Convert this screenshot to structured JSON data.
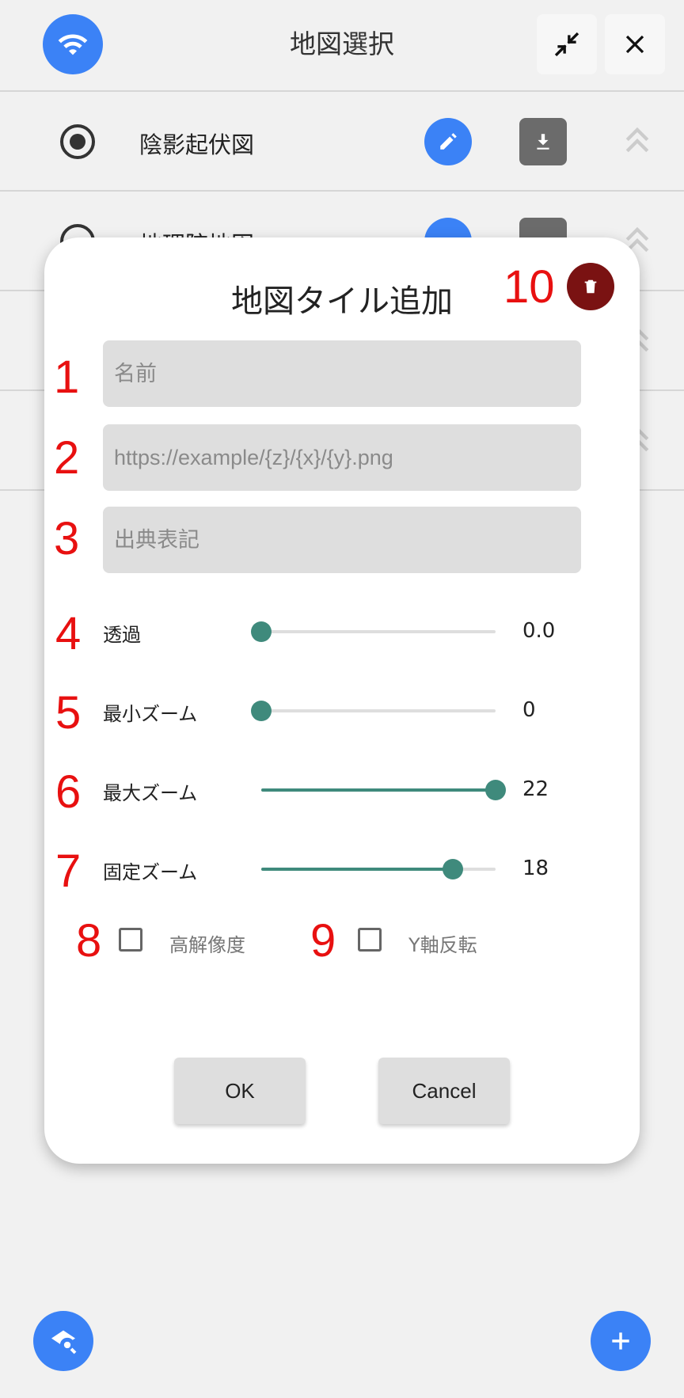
{
  "header": {
    "title": "地図選択",
    "icons": [
      "wifi-icon",
      "minimize-icon",
      "close-icon"
    ]
  },
  "list": {
    "items": [
      {
        "label": "陰影起伏図",
        "selected": true
      },
      {
        "label": "地理院地図",
        "selected": false
      },
      {
        "label": "",
        "selected": false
      },
      {
        "label": "",
        "selected": false
      }
    ]
  },
  "dialog": {
    "title": "地図タイル追加",
    "delete_number": "10",
    "fields": [
      {
        "number": "1",
        "placeholder": "名前",
        "value": ""
      },
      {
        "number": "2",
        "placeholder": "https://example/{z}/{x}/{y}.png",
        "value": ""
      },
      {
        "number": "3",
        "placeholder": "出典表記",
        "value": ""
      }
    ],
    "sliders": [
      {
        "number": "4",
        "label": "透過",
        "value": 0.0,
        "display": "0.0",
        "min": 0,
        "max": 1
      },
      {
        "number": "5",
        "label": "最小ズーム",
        "value": 0,
        "display": "0",
        "min": 0,
        "max": 22
      },
      {
        "number": "6",
        "label": "最大ズーム",
        "value": 22,
        "display": "22",
        "min": 0,
        "max": 22
      },
      {
        "number": "7",
        "label": "固定ズーム",
        "value": 18,
        "display": "18",
        "min": 0,
        "max": 22
      }
    ],
    "checkboxes": [
      {
        "number": "8",
        "label": "高解像度",
        "checked": false
      },
      {
        "number": "9",
        "label": "Y軸反転",
        "checked": false
      }
    ],
    "ok_label": "OK",
    "cancel_label": "Cancel"
  },
  "colors": {
    "accent": "#3b82f6",
    "slider": "#3f8a7c",
    "delete": "#7a1212",
    "annotation": "#e81010"
  }
}
